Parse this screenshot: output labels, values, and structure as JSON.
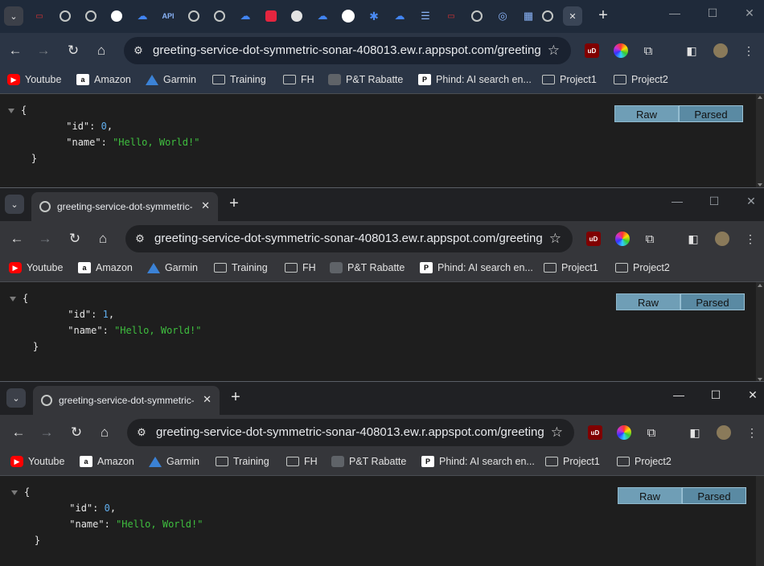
{
  "tab_title": "greeting-service-dot-symmetric-sonar-408013.ew.r.appspot.com/greeting",
  "url": "greeting-service-dot-symmetric-sonar-408013.ew.r.appspot.com/greeting",
  "pinned_tabs": [
    "vivaldi-icon",
    "globe-icon",
    "globe-icon",
    "key-icon",
    "cloud-icon",
    "api-icon",
    "globe-icon",
    "globe-icon",
    "cloud-icon",
    "arc-icon",
    "github-icon",
    "cloud-icon",
    "google-icon",
    "gear-icon",
    "cloud-icon",
    "list-icon",
    "vivaldi-icon",
    "globe-icon",
    "target-icon",
    "grid-icon",
    "globe-icon"
  ],
  "pinned_labels": {
    "api": "API"
  },
  "bookmarks": [
    {
      "label": "Youtube",
      "icon": "youtube-icon"
    },
    {
      "label": "Amazon",
      "icon": "amazon-icon"
    },
    {
      "label": "Garmin",
      "icon": "garmin-icon"
    },
    {
      "label": "Training",
      "icon": "folder-icon"
    },
    {
      "label": "FH",
      "icon": "folder-icon"
    },
    {
      "label": "P&T Rabatte",
      "icon": "pt-icon"
    },
    {
      "label": "Phind: AI search en...",
      "icon": "phind-icon"
    },
    {
      "label": "Project1",
      "icon": "folder-icon"
    },
    {
      "label": "Project2",
      "icon": "folder-icon"
    }
  ],
  "amazon_letter": "a",
  "phind_letter": "P",
  "ublock_label": "uD",
  "json_view": {
    "raw_label": "Raw",
    "parsed_label": "Parsed",
    "open_brace": "{",
    "close_brace": "}",
    "key_id": "\"id\"",
    "key_name": "\"name\"",
    "colon": ": ",
    "comma": ",",
    "name_value": "\"Hello, World!\""
  },
  "windows": [
    {
      "id_value": "0"
    },
    {
      "id_value": "1"
    },
    {
      "id_value": "0"
    }
  ],
  "accent_colors": {
    "number": "#61afef",
    "string": "#3fbf3f",
    "raw_button": "#6f9eb6"
  }
}
